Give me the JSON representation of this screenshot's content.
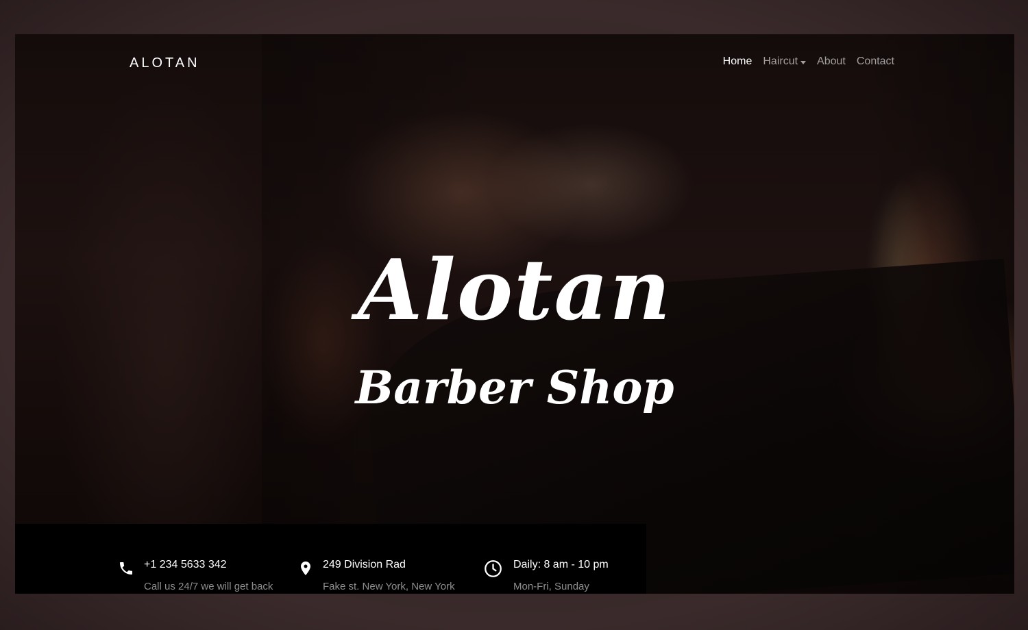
{
  "brand": "ALOTAN",
  "nav": {
    "items": [
      {
        "label": "Home",
        "active": true
      },
      {
        "label": "Haircut",
        "dropdown": true
      },
      {
        "label": "About"
      },
      {
        "label": "Contact"
      }
    ]
  },
  "hero": {
    "title": "Alotan",
    "subtitle": "Barber Shop"
  },
  "info": [
    {
      "icon": "phone-icon",
      "title": "+1 234 5633 342",
      "subtitle": "Call us 24/7 we will get back"
    },
    {
      "icon": "map-pin-icon",
      "title": "249 Division Rad",
      "subtitle": "Fake st. New York, New York"
    },
    {
      "icon": "clock-icon",
      "title": "Daily: 8 am - 10 pm",
      "subtitle": "Mon-Fri, Sunday"
    }
  ],
  "colors": {
    "page_frame": "#3a2a2b",
    "info_bar": "#000000",
    "text_primary": "#ffffff"
  }
}
